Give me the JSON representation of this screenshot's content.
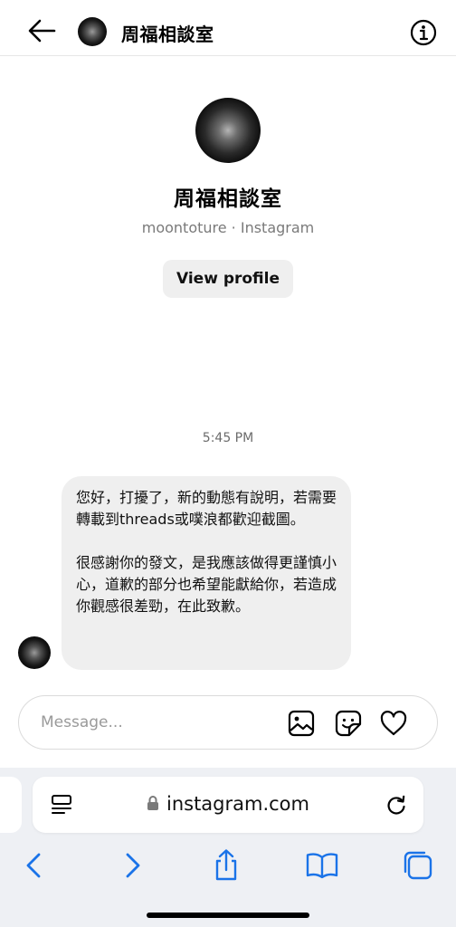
{
  "header": {
    "name": "周福相談室"
  },
  "profile": {
    "name": "周福相談室",
    "subtitle": "moontoture · Instagram",
    "view_profile_label": "View profile"
  },
  "thread": {
    "timestamp": "5:45 PM",
    "message": {
      "paragraph1": "您好，打擾了，新的動態有說明，若需要轉載到threads或噗浪都歡迎截圖。",
      "paragraph2": "很感謝你的發文，是我應該做得更謹慎小心，道歉的部分也希望能獻給你，若造成你觀感很差勁，在此致歉。"
    }
  },
  "composer": {
    "placeholder": "Message..."
  },
  "browser": {
    "url": "instagram.com"
  },
  "colors": {
    "accent": "#1a73e8",
    "bubble": "#efefef",
    "secondary_text": "#7a7a7a"
  },
  "icons": {
    "back": "arrow-left-icon",
    "info": "info-icon",
    "image": "image-icon",
    "sticker": "sticker-icon",
    "like": "heart-icon",
    "lock": "lock-icon",
    "reload": "reload-icon",
    "browser_back": "chevron-left-icon",
    "browser_forward": "chevron-right-icon",
    "share": "share-icon",
    "bookmarks": "book-icon",
    "tabs": "tabs-icon"
  }
}
